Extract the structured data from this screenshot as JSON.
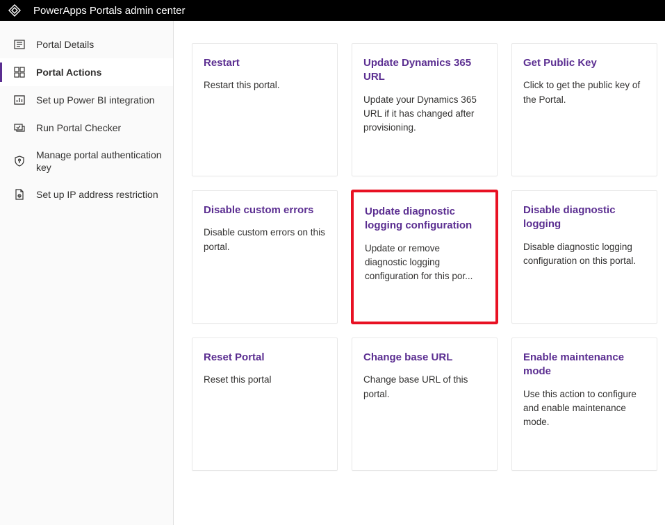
{
  "header": {
    "title": "PowerApps Portals admin center"
  },
  "sidebar": {
    "items": [
      {
        "label": "Portal Details"
      },
      {
        "label": "Portal Actions"
      },
      {
        "label": "Set up Power BI integration"
      },
      {
        "label": "Run Portal Checker"
      },
      {
        "label": "Manage portal authentication key"
      },
      {
        "label": "Set up IP address restriction"
      }
    ]
  },
  "cards": [
    {
      "title": "Restart",
      "desc": "Restart this portal."
    },
    {
      "title": "Update Dynamics 365 URL",
      "desc": "Update your Dynamics 365 URL if it has changed after provisioning."
    },
    {
      "title": "Get Public Key",
      "desc": "Click to get the public key of the Portal."
    },
    {
      "title": "Disable custom errors",
      "desc": "Disable custom errors on this portal."
    },
    {
      "title": "Update diagnostic logging configuration",
      "desc": "Update or remove diagnostic logging configuration for this por..."
    },
    {
      "title": "Disable diagnostic logging",
      "desc": "Disable diagnostic logging configuration on this portal."
    },
    {
      "title": "Reset Portal",
      "desc": "Reset this portal"
    },
    {
      "title": "Change base URL",
      "desc": "Change base URL of this portal."
    },
    {
      "title": "Enable maintenance mode",
      "desc": "Use this action to configure and enable maintenance mode."
    }
  ]
}
